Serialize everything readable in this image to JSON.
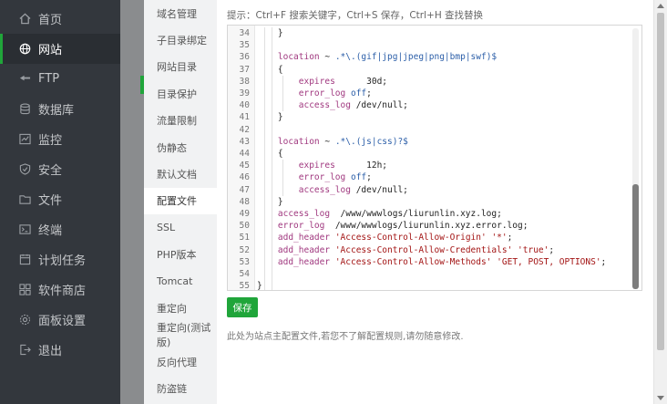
{
  "sidebar": {
    "items": [
      {
        "label": "首页",
        "icon": "home-icon"
      },
      {
        "label": "网站",
        "icon": "globe-icon",
        "active": true
      },
      {
        "label": "FTP",
        "icon": "ftp-icon"
      },
      {
        "label": "数据库",
        "icon": "database-icon"
      },
      {
        "label": "监控",
        "icon": "monitor-icon"
      },
      {
        "label": "安全",
        "icon": "shield-icon"
      },
      {
        "label": "文件",
        "icon": "folder-icon"
      },
      {
        "label": "终端",
        "icon": "terminal-icon"
      },
      {
        "label": "计划任务",
        "icon": "clock-icon"
      },
      {
        "label": "软件商店",
        "icon": "grid-icon"
      },
      {
        "label": "面板设置",
        "icon": "gear-icon"
      },
      {
        "label": "退出",
        "icon": "logout-icon"
      }
    ]
  },
  "tabs": {
    "items": [
      {
        "label": "域名管理"
      },
      {
        "label": "子目录绑定"
      },
      {
        "label": "网站目录"
      },
      {
        "label": "目录保护"
      },
      {
        "label": "流量限制"
      },
      {
        "label": "伪静态"
      },
      {
        "label": "默认文档"
      },
      {
        "label": "配置文件",
        "active": true
      },
      {
        "label": "SSL"
      },
      {
        "label": "PHP版本"
      },
      {
        "label": "Tomcat"
      },
      {
        "label": "重定向"
      },
      {
        "label": "重定向(测试版)"
      },
      {
        "label": "反向代理"
      },
      {
        "label": "防盗链"
      }
    ]
  },
  "editor": {
    "hint": "提示：Ctrl+F 搜索关键字，Ctrl+S 保存，Ctrl+H 查找替换",
    "lines": [
      {
        "n": "34",
        "t": "    }"
      },
      {
        "n": "35",
        "t": ""
      },
      {
        "n": "36",
        "t": "    location ~ .*\\.(gif|jpg|jpeg|png|bmp|swf)$"
      },
      {
        "n": "37",
        "t": "    {"
      },
      {
        "n": "38",
        "t": "        expires      30d;"
      },
      {
        "n": "39",
        "t": "        error_log off;"
      },
      {
        "n": "40",
        "t": "        access_log /dev/null;"
      },
      {
        "n": "41",
        "t": "    }"
      },
      {
        "n": "42",
        "t": ""
      },
      {
        "n": "43",
        "t": "    location ~ .*\\.(js|css)?$"
      },
      {
        "n": "44",
        "t": "    {"
      },
      {
        "n": "45",
        "t": "        expires      12h;"
      },
      {
        "n": "46",
        "t": "        error_log off;"
      },
      {
        "n": "47",
        "t": "        access_log /dev/null;"
      },
      {
        "n": "48",
        "t": "    }"
      },
      {
        "n": "49",
        "t": "    access_log  /www/wwwlogs/liurunlin.xyz.log;"
      },
      {
        "n": "50",
        "t": "    error_log  /www/wwwlogs/liurunlin.xyz.error.log;"
      },
      {
        "n": "51",
        "t": "    add_header 'Access-Control-Allow-Origin' '*';"
      },
      {
        "n": "52",
        "t": "    add_header 'Access-Control-Allow-Credentials' 'true';"
      },
      {
        "n": "53",
        "t": "    add_header 'Access-Control-Allow-Methods' 'GET, POST, OPTIONS';"
      },
      {
        "n": "54",
        "t": ""
      },
      {
        "n": "55",
        "t": "}"
      }
    ]
  },
  "actions": {
    "save_label": "保存",
    "note": "此处为站点主配置文件,若您不了解配置规则,请勿随意修改."
  },
  "colors": {
    "brand_green": "#20a53a",
    "sidebar_bg": "#33373d"
  }
}
